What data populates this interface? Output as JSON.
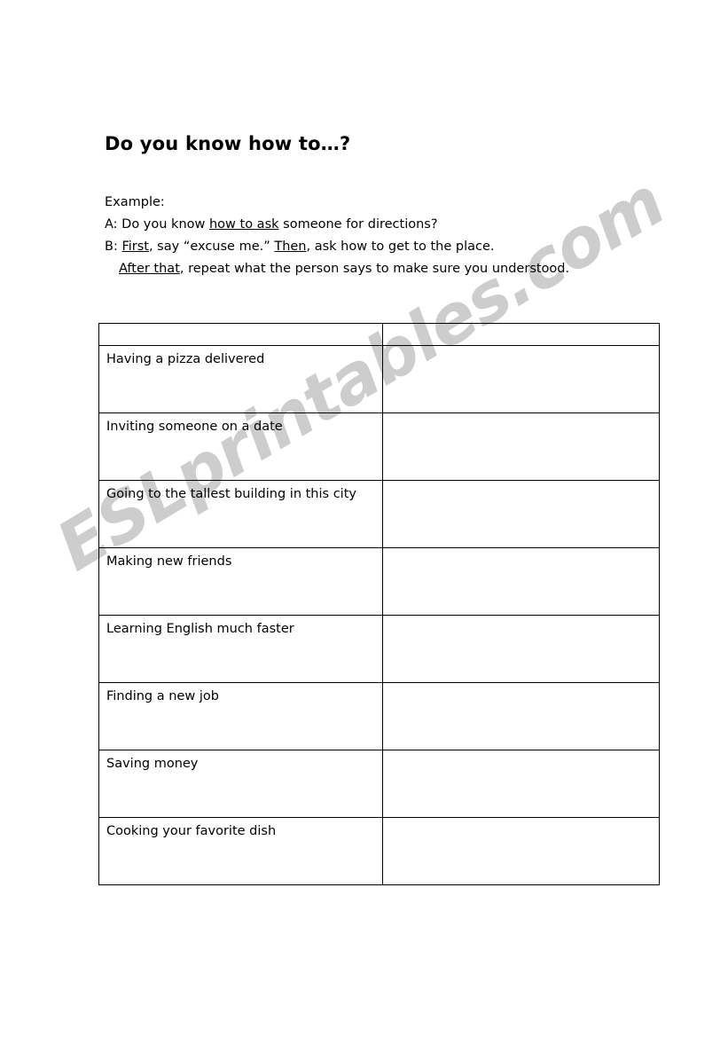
{
  "document": {
    "title": "Do you know how to…?",
    "type": "esl-worksheet"
  },
  "example": {
    "label": "Example:",
    "lines": [
      {
        "id": "line-a",
        "segments": [
          {
            "text": "A: Do you know ",
            "underline": false
          },
          {
            "text": "how to ask",
            "underline": true
          },
          {
            "text": " someone for directions?",
            "underline": false
          }
        ]
      },
      {
        "id": "line-b",
        "segments": [
          {
            "text": "B: ",
            "underline": false
          },
          {
            "text": "First",
            "underline": true
          },
          {
            "text": ", say “excuse me.” ",
            "underline": false
          },
          {
            "text": "Then",
            "underline": true
          },
          {
            "text": ", ask how to get to the place.",
            "underline": false
          }
        ]
      },
      {
        "id": "line-c",
        "indent": true,
        "segments": [
          {
            "text": "After that",
            "underline": true
          },
          {
            "text": ", repeat what the person says to make sure you understood.",
            "underline": false
          }
        ]
      }
    ]
  },
  "table": {
    "columns": [
      {
        "id": "col-prompt",
        "header": ""
      },
      {
        "id": "col-answer",
        "header": ""
      }
    ],
    "rows": [
      {
        "prompt": "Having a pizza delivered",
        "answer": ""
      },
      {
        "prompt": "Inviting someone on a date",
        "answer": ""
      },
      {
        "prompt": "Going to the tallest building in this city",
        "answer": ""
      },
      {
        "prompt": "Making new friends",
        "answer": ""
      },
      {
        "prompt": "Learning English much faster",
        "answer": ""
      },
      {
        "prompt": "Finding a new job",
        "answer": ""
      },
      {
        "prompt": "Saving money",
        "answer": ""
      },
      {
        "prompt": "Cooking your favorite dish",
        "answer": ""
      }
    ]
  },
  "watermark": {
    "text": "ESLprintables.com",
    "color": "#cdcdcd"
  },
  "colors": {
    "page_background": "#ffffff",
    "text": "#000000",
    "table_border": "#000000",
    "watermark": "#cdcdcd"
  }
}
